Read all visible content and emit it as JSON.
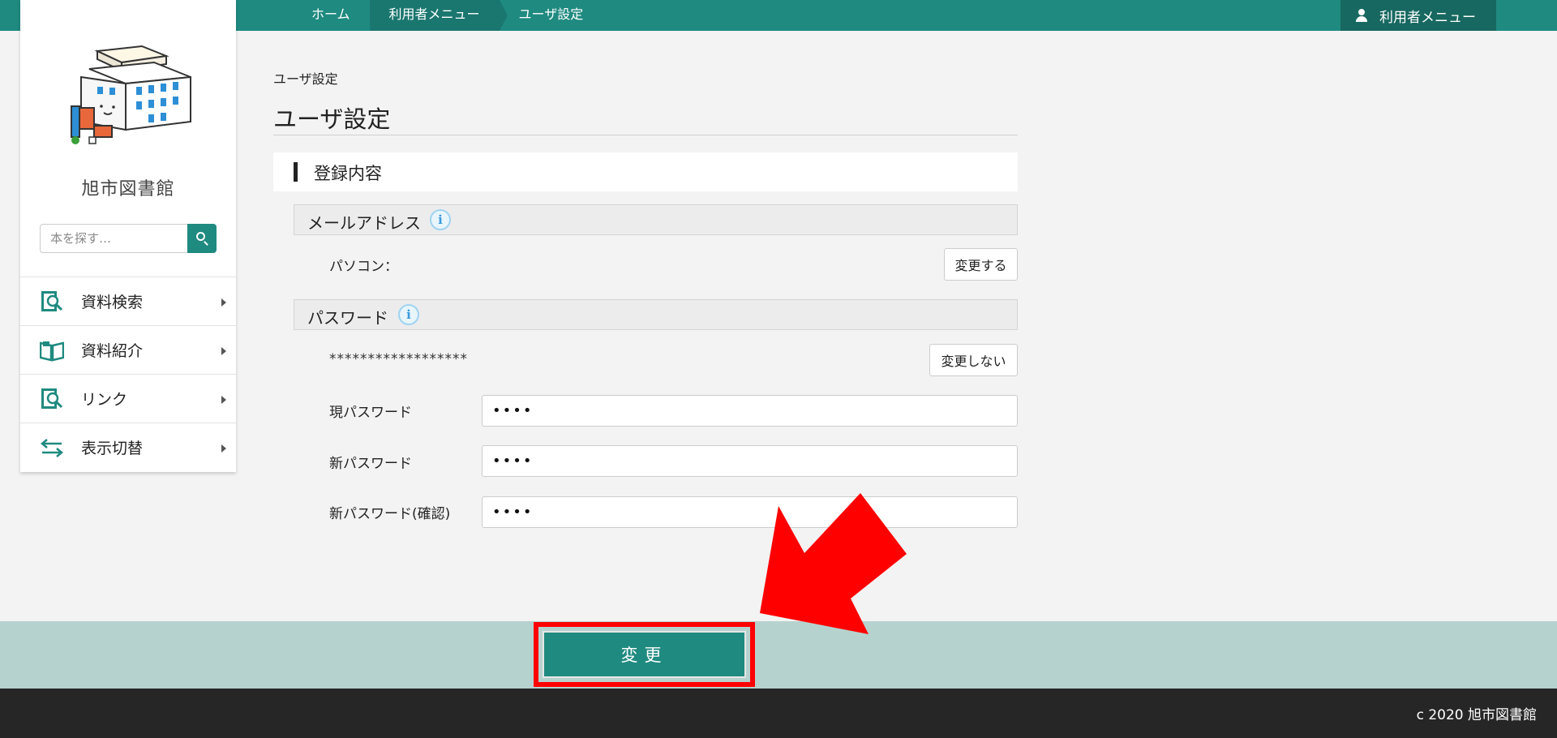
{
  "breadcrumb": {
    "items": [
      "ホーム",
      "利用者メニュー",
      "ユーザ設定"
    ]
  },
  "header": {
    "user_menu_label": "利用者メニュー"
  },
  "sidebar": {
    "library_name": "旭市図書館",
    "search_placeholder": "本を探す…",
    "nav_items": [
      {
        "label": "資料検索",
        "icon": "document-search-icon"
      },
      {
        "label": "資料紹介",
        "icon": "open-book-icon"
      },
      {
        "label": "リンク",
        "icon": "document-search-icon"
      },
      {
        "label": "表示切替",
        "icon": "swap-arrows-icon"
      }
    ]
  },
  "main": {
    "small_title": "ユーザ設定",
    "page_title": "ユーザ設定",
    "section_title": "登録内容",
    "email": {
      "heading": "メールアドレス",
      "info_glyph": "i",
      "pc_label": "パソコン：",
      "change_button": "変更する"
    },
    "password": {
      "heading": "パスワード",
      "info_glyph": "i",
      "masked": "******************",
      "no_change_button": "変更しない",
      "current_label": "現パスワード",
      "current_value": "••••",
      "new_label": "新パスワード",
      "new_value": "••••",
      "confirm_label": "新パスワード(確認)",
      "confirm_value": "••••"
    },
    "submit_label": "変更"
  },
  "footer": {
    "copyright": "c 2020 旭市図書館"
  },
  "colors": {
    "teal": "#1f8a80",
    "teal_dark": "#176860",
    "strip": "#b6d2ce",
    "highlight": "#ff0000",
    "footer": "#262626"
  }
}
